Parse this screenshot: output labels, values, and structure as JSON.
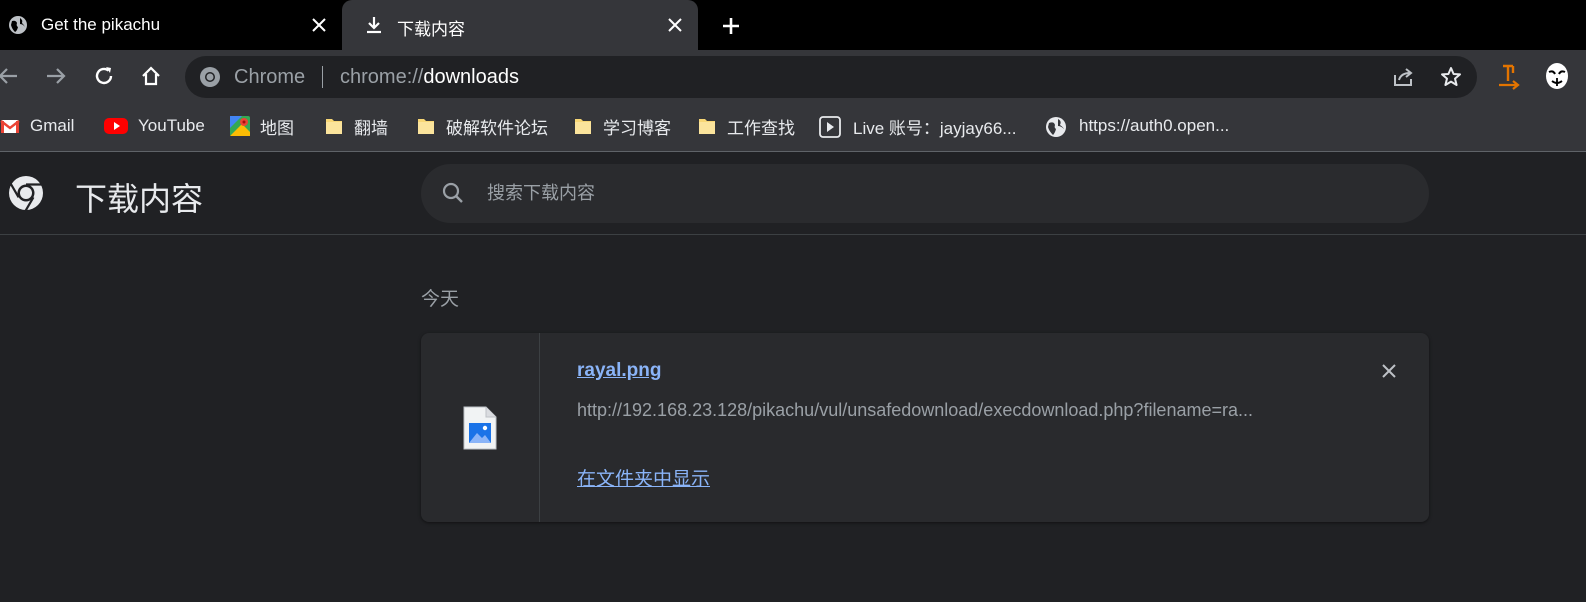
{
  "tabs": [
    {
      "title": "Get the pikachu",
      "icon": "globe-icon",
      "active": false
    },
    {
      "title": "下载内容",
      "icon": "download-icon",
      "active": true
    }
  ],
  "omnibox": {
    "site_label": "Chrome",
    "url_scheme": "chrome://",
    "url_host": "downloads"
  },
  "bookmarks": [
    {
      "label": "Gmail",
      "icon": "gmail-icon"
    },
    {
      "label": "YouTube",
      "icon": "youtube-icon"
    },
    {
      "label": "地图",
      "icon": "maps-icon"
    },
    {
      "label": "翻墙",
      "icon": "folder-icon"
    },
    {
      "label": "破解软件论坛",
      "icon": "folder-icon"
    },
    {
      "label": "学习博客",
      "icon": "folder-icon"
    },
    {
      "label": "工作查找",
      "icon": "folder-icon"
    },
    {
      "label": "Live  账号：jayjay66...",
      "icon": "play-icon"
    },
    {
      "label": "https://auth0.open...",
      "icon": "globe-icon"
    }
  ],
  "page": {
    "title": "下载内容",
    "search_placeholder": "搜索下载内容",
    "date_group": "今天",
    "download": {
      "file_name": "rayal.png",
      "url": "http://192.168.23.128/pikachu/vul/unsafedownload/execdownload.php?filename=ra...",
      "show_in_folder": "在文件夹中显示"
    }
  },
  "colors": {
    "link": "#8ab4f8",
    "background": "#202124",
    "toolbar": "#35363a"
  }
}
